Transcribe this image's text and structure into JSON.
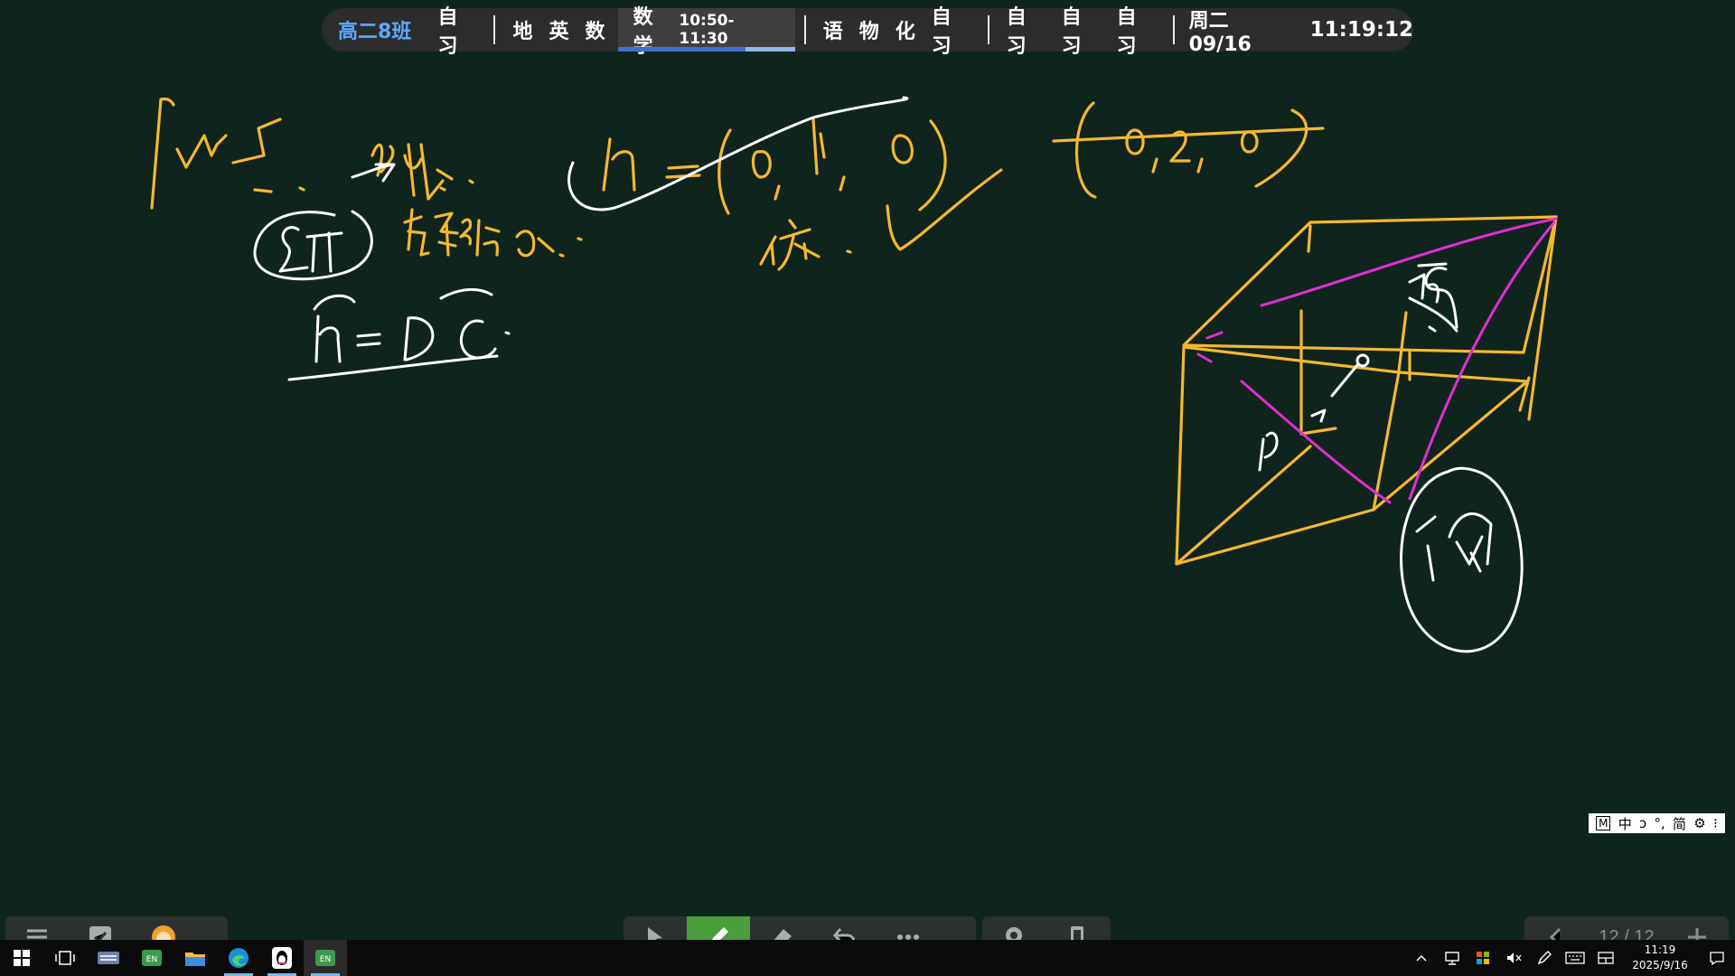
{
  "schedule": {
    "class_name": "高二8班",
    "slots_before": [
      "自习",
      "地",
      "英",
      "数"
    ],
    "current_subject": "数学",
    "current_time": "10:50-11:30",
    "current_progress": 0.72,
    "slots_after_1": [
      "语",
      "物",
      "化",
      "自习"
    ],
    "slots_after_2": [
      "自习",
      "自习",
      "自习"
    ],
    "date": "周二 09/16",
    "clock": "11:19:12"
  },
  "ime": {
    "mode_badge": "M",
    "lang": "中",
    "shape": "ↄ",
    "punct": "°,",
    "script": "简",
    "settings_icon": "gear-icon",
    "more": "⁝"
  },
  "page_indicator": {
    "text": "12 / 12"
  },
  "taskbar": {
    "date": "2025/9/16",
    "time": "11:19",
    "apps": [
      "windows-start",
      "task-view",
      "keyboard-app",
      "en-input-app",
      "file-explorer",
      "edge",
      "qq",
      "en-input-app-2"
    ]
  },
  "colors": {
    "board": "#10241e",
    "ink_yellow": "#f5b82e",
    "ink_white": "#ffffff",
    "ink_magenta": "#e02fd2",
    "accent_blue": "#5ea8ff",
    "tool_active": "#4a9e3c"
  }
}
